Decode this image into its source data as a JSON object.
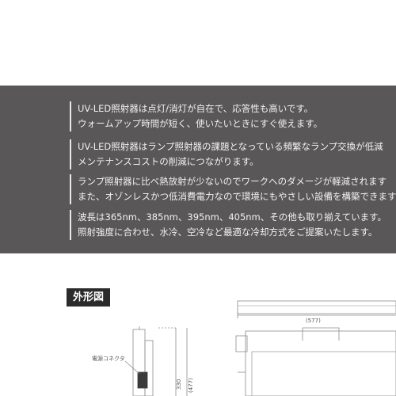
{
  "features": [
    {
      "line1": "UV-LED照射器は点灯/消灯が自在で、応答性も高いです。",
      "line2": "ウォームアップ時間が短く、使いたいときにすぐ使えます。"
    },
    {
      "line1": "UV-LED照射器はランプ照射器の課題となっている頻繁なランプ交換が低減",
      "line2": "メンテナンスコストの削減につながります。"
    },
    {
      "line1": "ランプ照射器に比べ熱放射が少ないのでワークへのダメージが軽減されます",
      "line2": "また、オゾンレスかつ低消費電力なので環境にもやさしい設備を構築できます"
    },
    {
      "line1": "波長は365nm、385nm、395nm、405nm、その他も取り揃えています。",
      "line2": "照射強度に合わせ、水冷、空冷など最適な冷却方式をご提案いたします。"
    }
  ],
  "outline": {
    "title": "外形図",
    "connector_label": "電源コネクタ",
    "dim_width": "(577)",
    "dim_height": "330",
    "dim_height_total": "(477)"
  },
  "colors": {
    "band": "#595757",
    "text": "#f2f2f2",
    "label_bg": "#2b2b2b"
  }
}
